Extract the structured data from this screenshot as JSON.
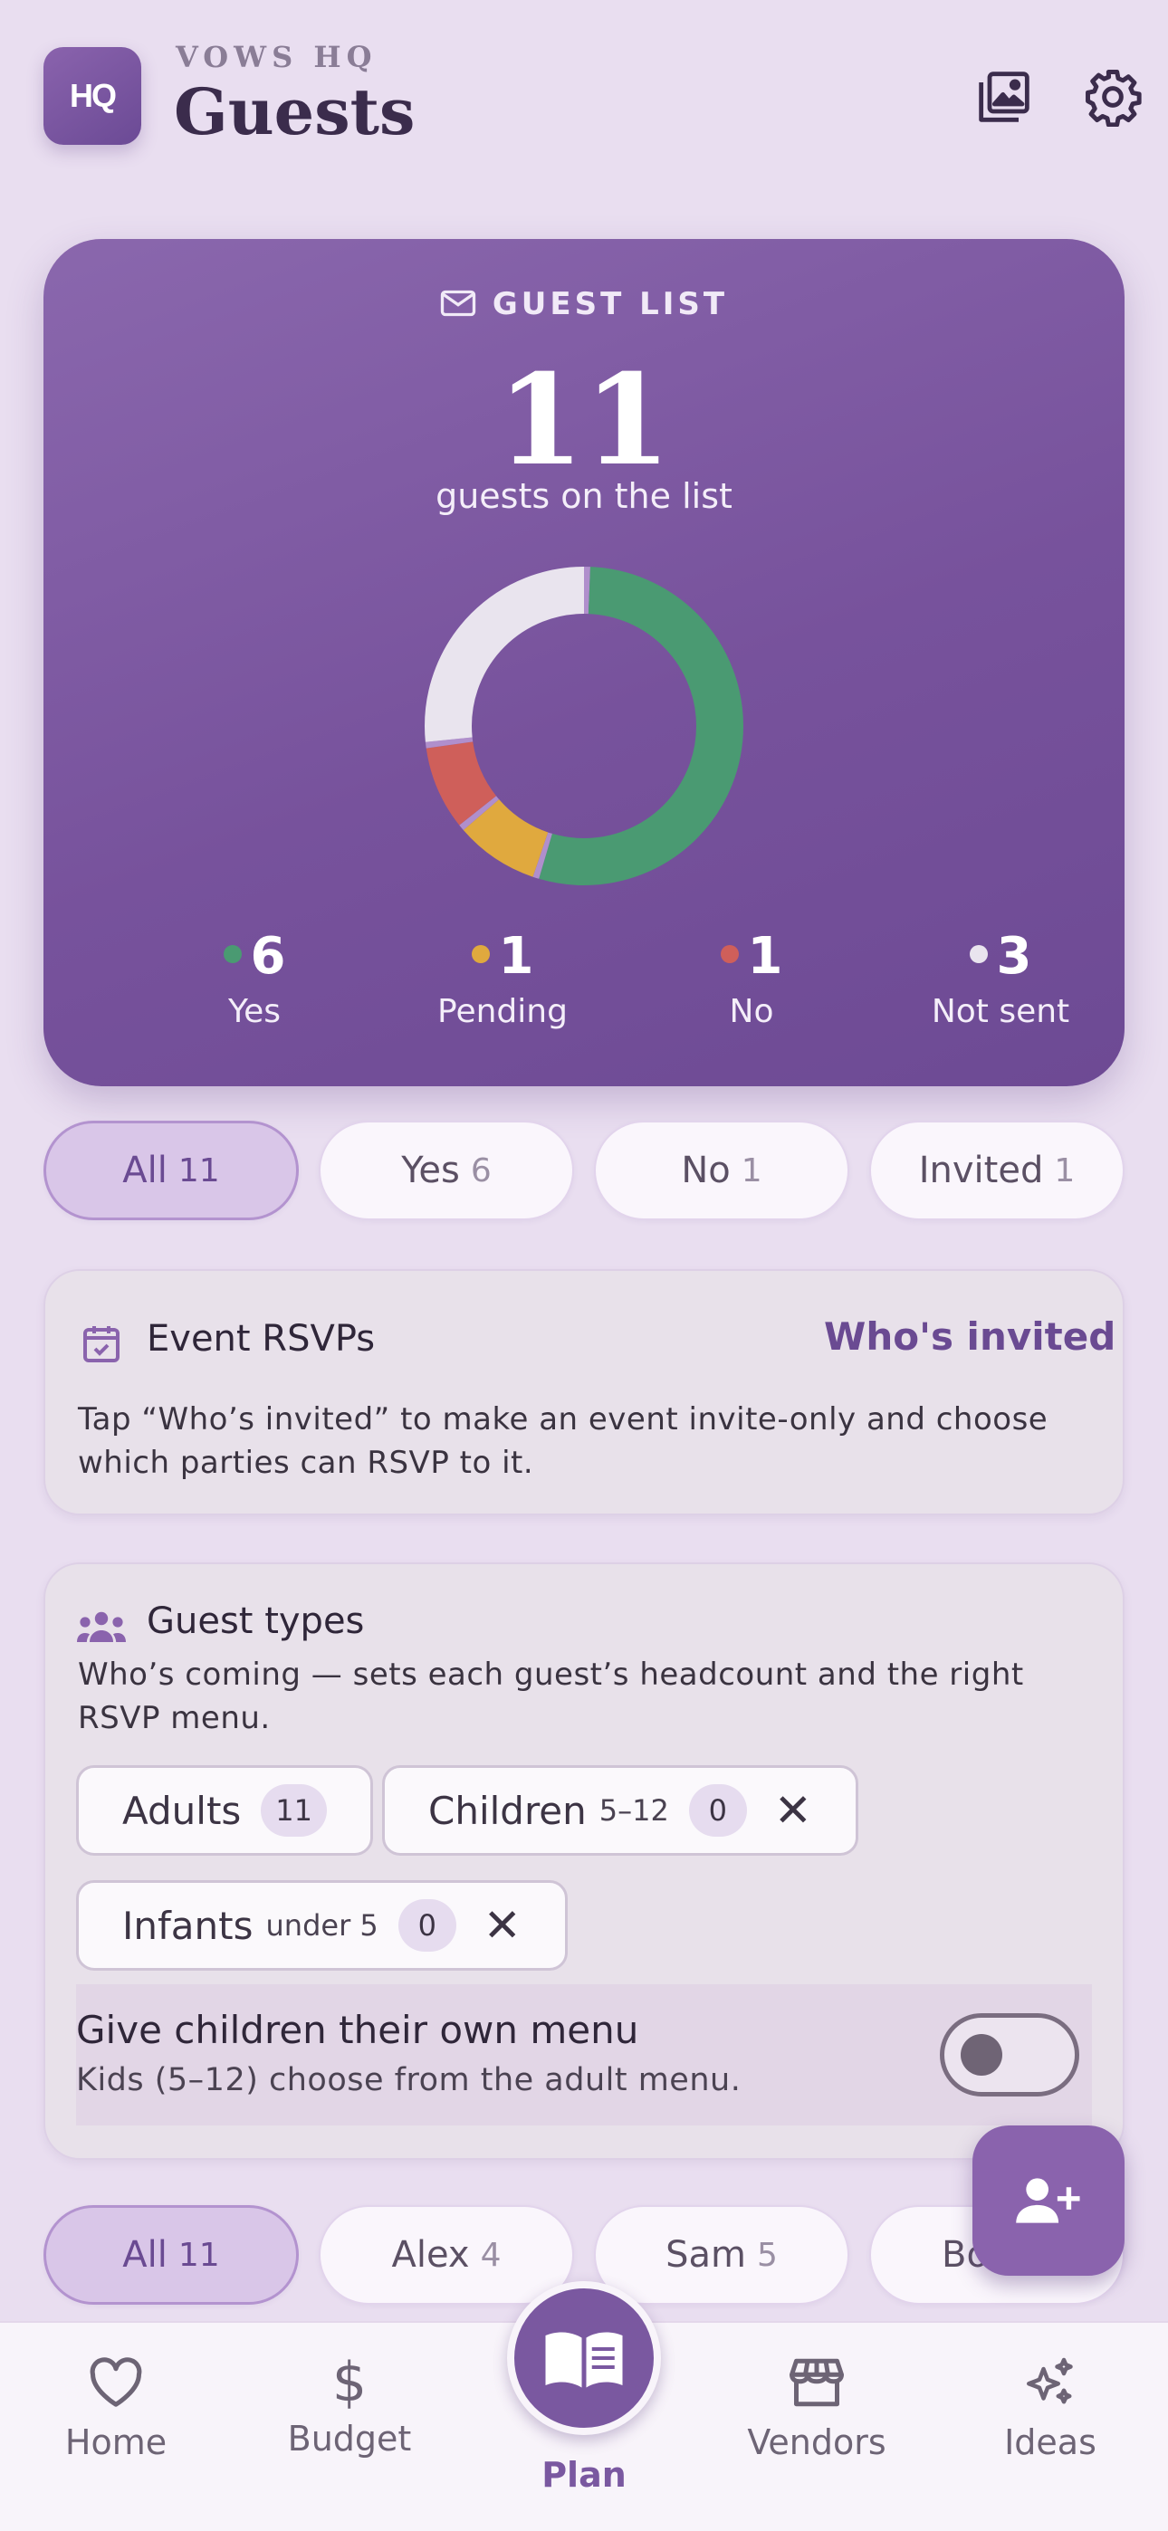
{
  "header": {
    "logo_text": "HQ",
    "brand": "VOWS HQ",
    "title": "Guests",
    "gallery_icon": "gallery-icon",
    "settings_icon": "gear-icon"
  },
  "summary": {
    "label": "GUEST LIST",
    "count": "11",
    "subtitle": "guests on the list",
    "chart_data": {
      "type": "pie",
      "categories": [
        "Yes",
        "Pending",
        "No",
        "Not sent"
      ],
      "values": [
        6,
        1,
        1,
        3
      ],
      "colors": [
        "#4a9a72",
        "#e0a93e",
        "#cf5f5a",
        "#e9e4ee"
      ]
    },
    "stats": [
      {
        "value": "6",
        "label": "Yes",
        "color": "#4a9a72"
      },
      {
        "value": "1",
        "label": "Pending",
        "color": "#e0a93e"
      },
      {
        "value": "1",
        "label": "No",
        "color": "#cf5f5a"
      },
      {
        "value": "3",
        "label": "Not sent",
        "color": "#e9e4ee"
      }
    ]
  },
  "rsvp_filters": [
    {
      "label": "All",
      "count": "11",
      "active": true
    },
    {
      "label": "Yes",
      "count": "6"
    },
    {
      "label": "No",
      "count": "1"
    },
    {
      "label": "Invited",
      "count": "1"
    }
  ],
  "event_rsvps": {
    "title": "Event RSVPs",
    "link": "Who's invited",
    "text": "Tap “Who’s invited” to make an event invite-only and choose which parties can RSVP to it."
  },
  "guest_types": {
    "title": "Guest types",
    "text": "Who’s coming — sets each guest’s headcount and the right RSVP menu.",
    "types": [
      {
        "label": "Adults",
        "range": "",
        "count": "11"
      },
      {
        "label": "Children",
        "range": "5–12",
        "count": "0"
      },
      {
        "label": "Infants",
        "range": "under 5",
        "count": "0"
      }
    ],
    "menu_title": "Give children their own menu",
    "menu_sub": "Kids (5–12) choose from the adult menu.",
    "menu_toggle_on": false
  },
  "party_filters": [
    {
      "label": "All",
      "count": "11",
      "active": true
    },
    {
      "label": "Alex",
      "count": "4"
    },
    {
      "label": "Sam",
      "count": "5"
    },
    {
      "label": "Bo",
      "count": ""
    }
  ],
  "nav": {
    "home": "Home",
    "budget": "Budget",
    "plan": "Plan",
    "vendors": "Vendors",
    "ideas": "Ideas"
  }
}
